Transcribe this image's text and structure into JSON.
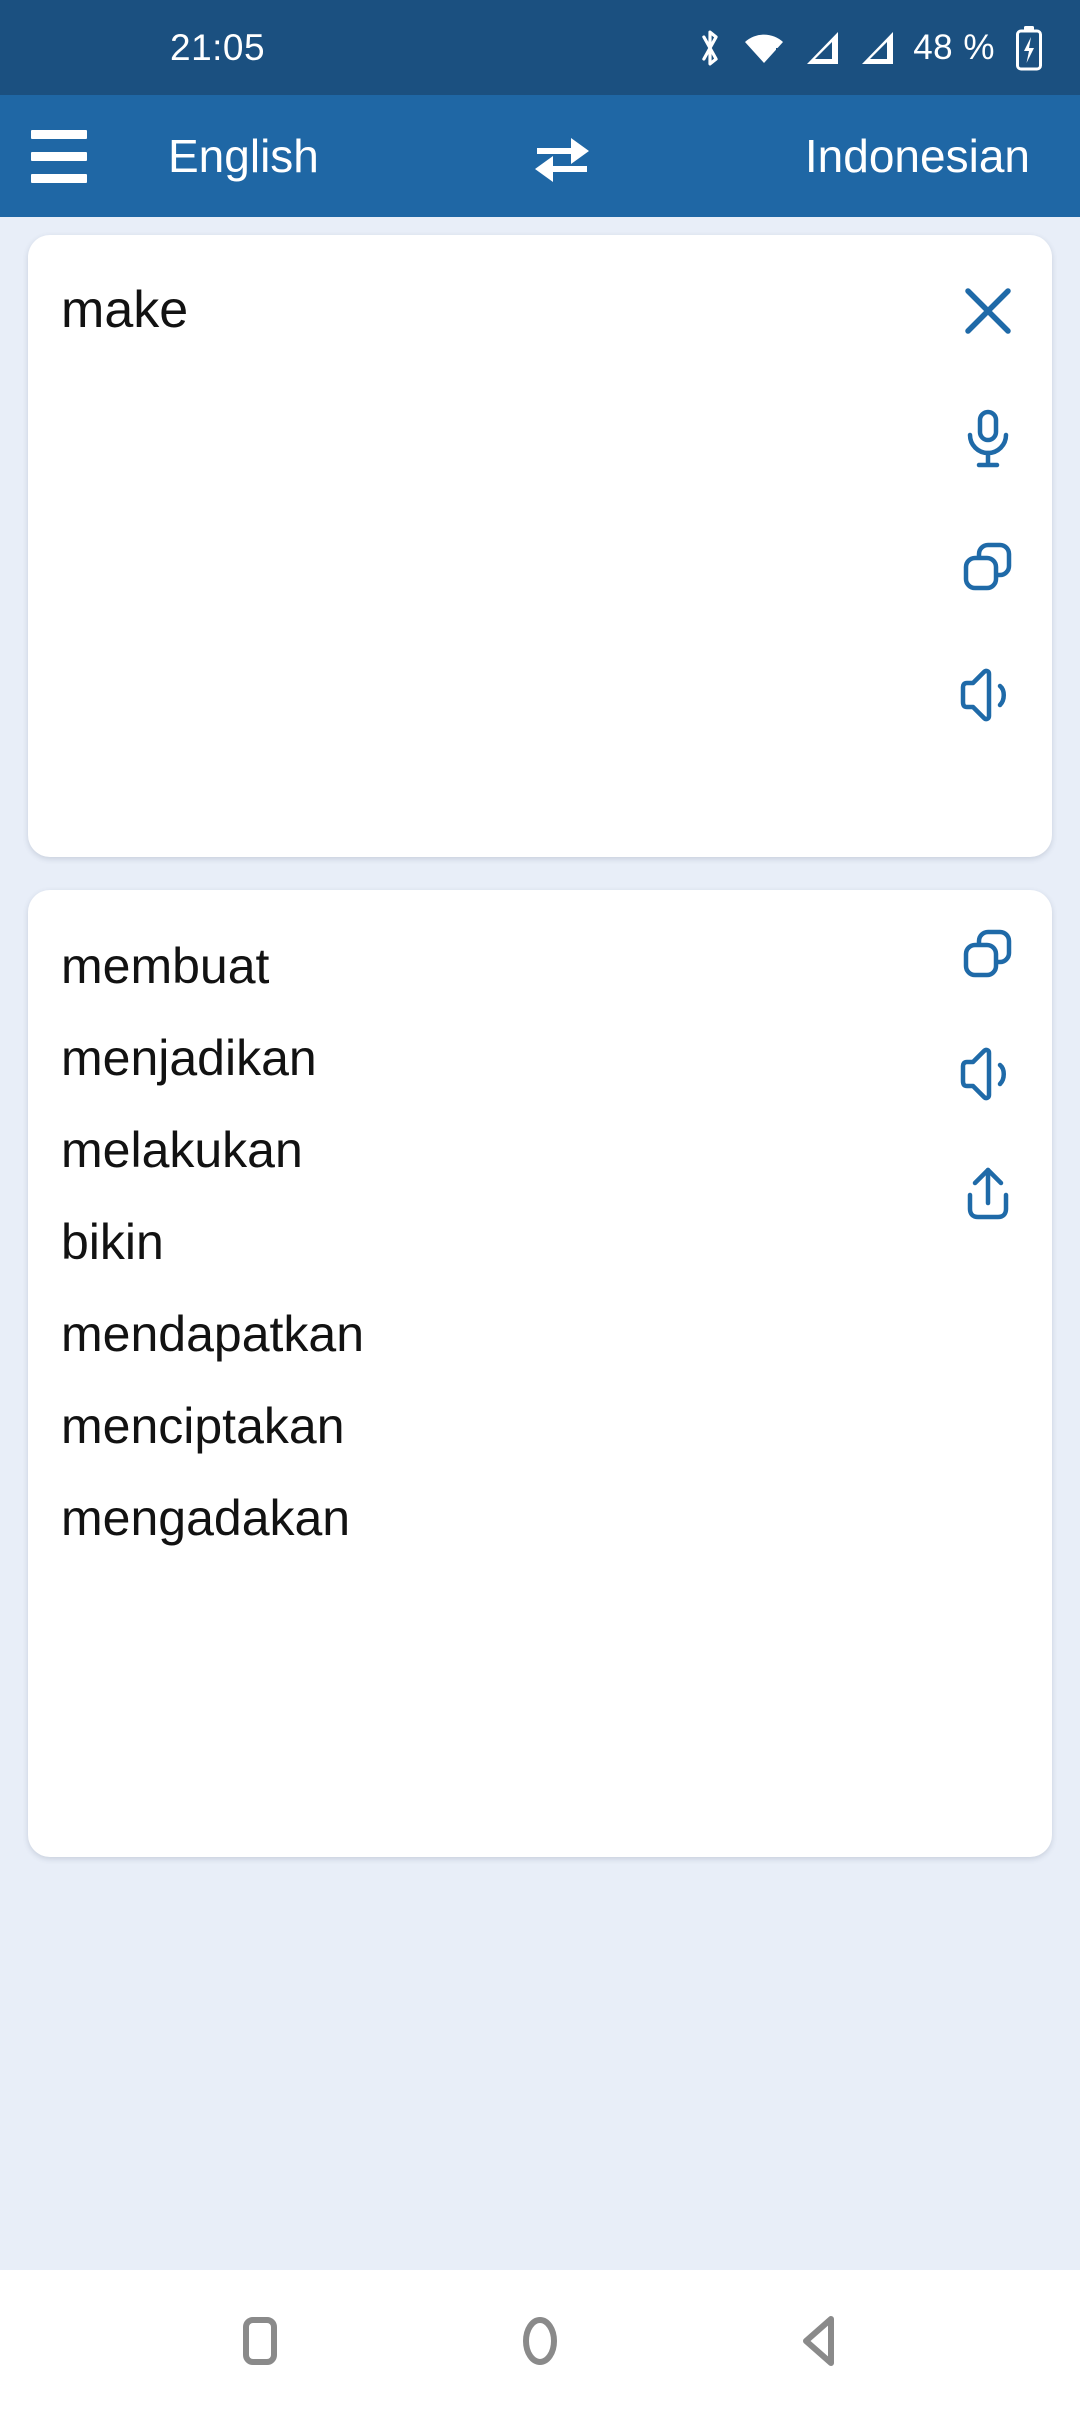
{
  "status_bar": {
    "time": "21:05",
    "battery_percent": "48 %",
    "icons": [
      "bluetooth-icon",
      "wifi-icon",
      "signal-icon-1",
      "signal-icon-2",
      "battery-charging-icon"
    ],
    "background_color": "#1b5080"
  },
  "toolbar": {
    "menu_icon": "hamburger-menu-icon",
    "source_language": "English",
    "swap_icon": "swap-languages-icon",
    "target_language": "Indonesian",
    "background_color": "#1f67a5"
  },
  "input_card": {
    "text": "make",
    "actions": [
      {
        "name": "clear-button",
        "icon": "close-icon"
      },
      {
        "name": "voice-input-button",
        "icon": "microphone-icon"
      },
      {
        "name": "copy-input-button",
        "icon": "copy-icon"
      },
      {
        "name": "speak-input-button",
        "icon": "speaker-icon"
      }
    ]
  },
  "results_card": {
    "items": [
      "membuat",
      "menjadikan",
      "melakukan",
      "bikin",
      "mendapatkan",
      "menciptakan",
      "mengadakan"
    ],
    "actions": [
      {
        "name": "copy-result-button",
        "icon": "copy-icon"
      },
      {
        "name": "speak-result-button",
        "icon": "speaker-icon"
      },
      {
        "name": "share-result-button",
        "icon": "share-icon"
      }
    ]
  },
  "navigation_bar": {
    "recents_label": "Recents",
    "home_label": "Home",
    "back_label": "Back"
  },
  "colors": {
    "accent": "#1f6aa8",
    "page_background": "#e8eef8",
    "card_background": "#ffffff",
    "text_primary": "#121212"
  }
}
